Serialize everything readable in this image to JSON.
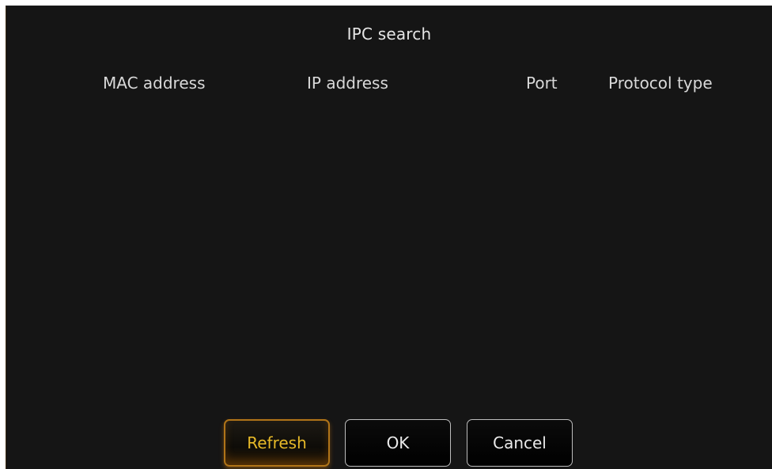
{
  "dialog": {
    "title": "IPC search"
  },
  "table": {
    "columns": [
      "MAC address",
      "IP address",
      "Port",
      "Protocol type"
    ],
    "rows": []
  },
  "buttons": {
    "refresh_label": "Refresh",
    "ok_label": "OK",
    "cancel_label": "Cancel"
  },
  "colors": {
    "background": "#151515",
    "accent": "#e7b928",
    "accent_border": "#b07418",
    "text": "#e6e6e6"
  }
}
